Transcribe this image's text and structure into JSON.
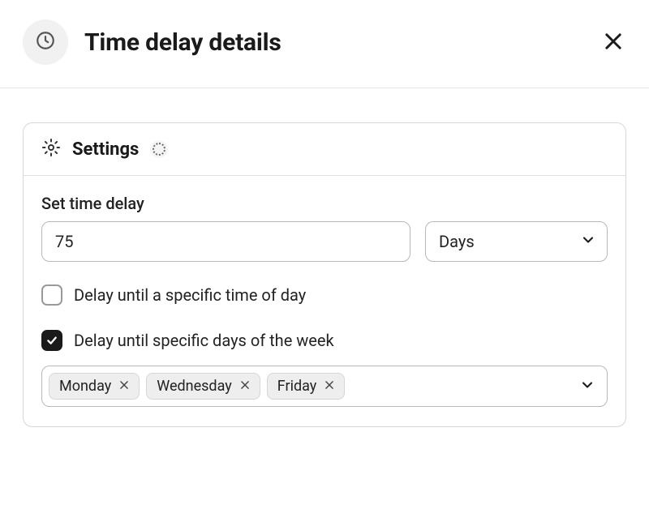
{
  "header": {
    "title": "Time delay details"
  },
  "settings": {
    "title": "Settings",
    "delay_label": "Set time delay",
    "delay_value": "75",
    "delay_unit": "Days",
    "checkbox_time_of_day": {
      "label": "Delay until a specific time of day",
      "checked": false
    },
    "checkbox_days_of_week": {
      "label": "Delay until specific days of the week",
      "checked": true
    },
    "selected_days": [
      "Monday",
      "Wednesday",
      "Friday"
    ]
  }
}
